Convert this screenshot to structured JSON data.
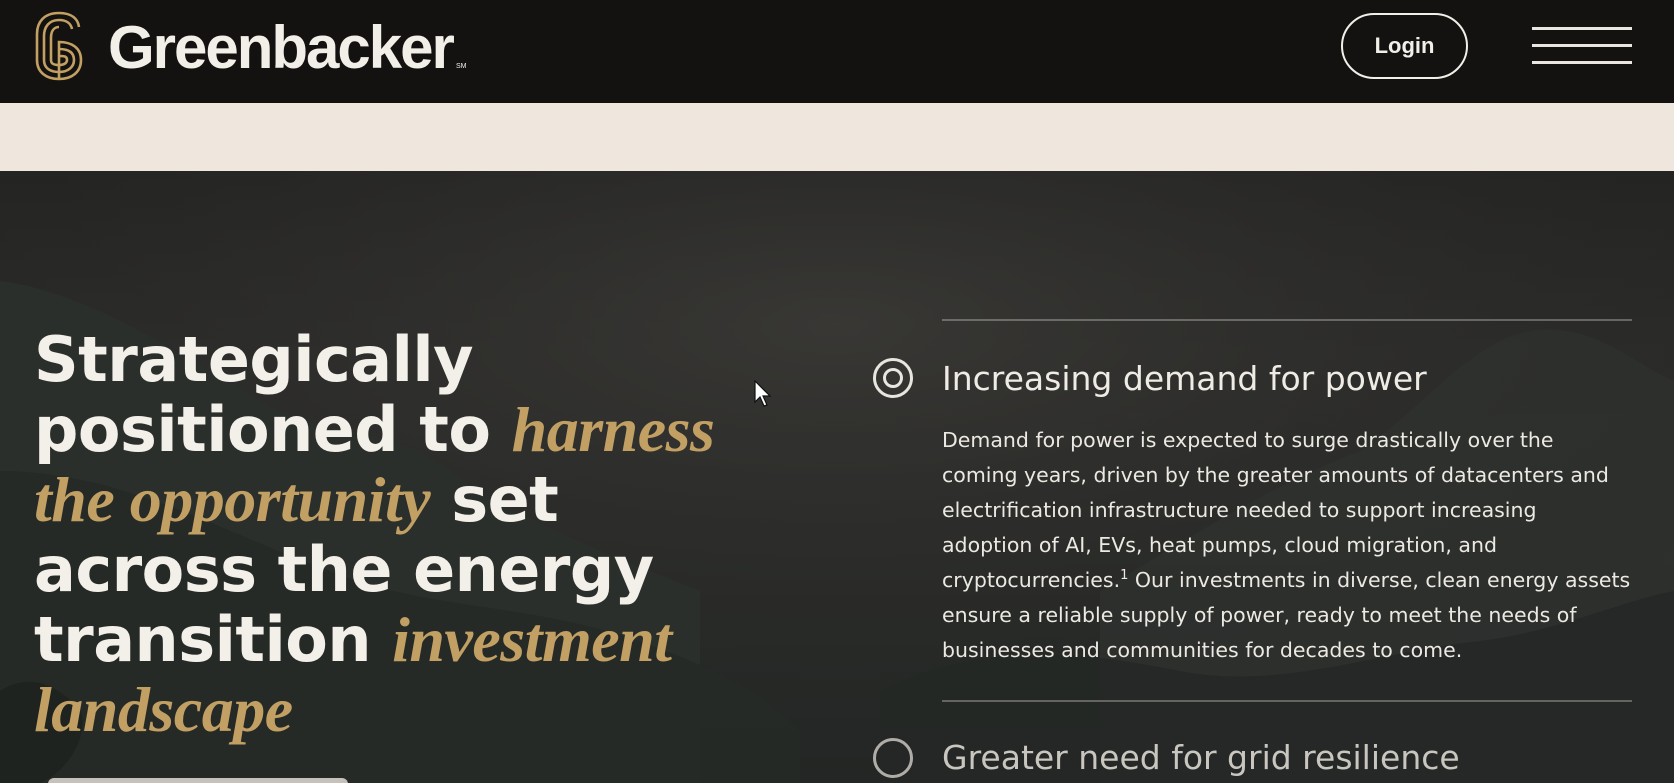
{
  "header": {
    "logo_text": "Greenbacker",
    "logo_sm": "SM",
    "login_label": "Login",
    "menu_icon": "hamburger-menu-icon"
  },
  "hero": {
    "headline": {
      "part1": "Strategically positioned to ",
      "em1": "harness the opportunity",
      "part2": " set across the energy transition ",
      "em2": "investment landscape"
    },
    "accordion": [
      {
        "title": "Increasing demand for power",
        "body_before_sup": "Demand for power is expected to surge drastically over the coming years, driven by the greater amounts of datacenters and electrification infrastructure needed to support increasing adoption of AI, EVs, heat pumps, cloud migration, and cryptocurrencies.",
        "footnote": "1",
        "body_after_sup": " Our investments in diverse, clean energy assets ensure a reliable supply of power, ready to meet the needs of businesses and communities for decades to come.",
        "expanded": true
      },
      {
        "title": "Greater need for grid resilience",
        "expanded": false
      }
    ]
  },
  "colors": {
    "accent_gold": "#c2a064",
    "header_bg": "#141210",
    "cream": "#efe7dd",
    "text_light": "#f3efe9"
  }
}
